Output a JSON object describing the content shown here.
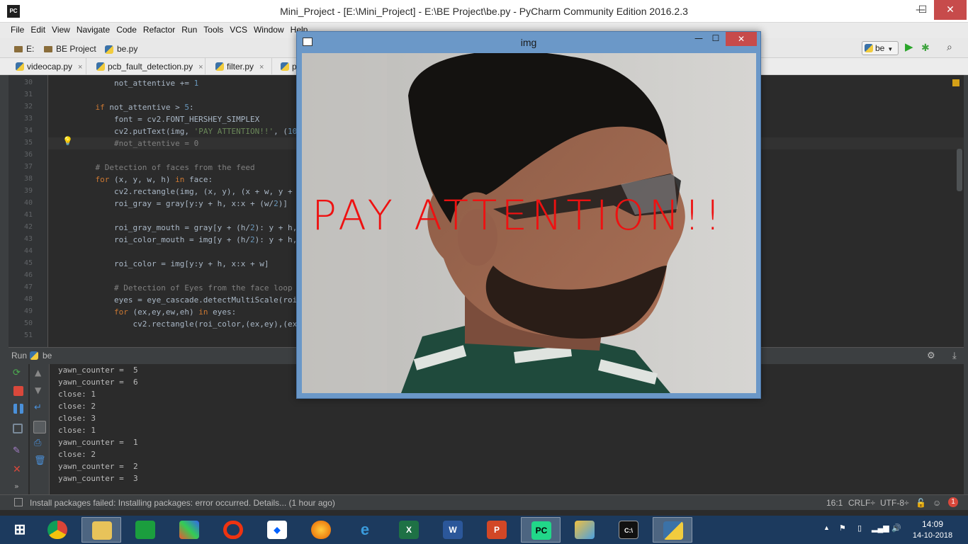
{
  "window": {
    "title": "Mini_Project - [E:\\Mini_Project] - E:\\BE Project\\be.py - PyCharm Community Edition 2016.2.3",
    "logo_text": "PC",
    "minimize": "—",
    "maximize": "☐",
    "close": "✕"
  },
  "menu": [
    "File",
    "Edit",
    "View",
    "Navigate",
    "Code",
    "Refactor",
    "Run",
    "Tools",
    "VCS",
    "Window",
    "Help"
  ],
  "breadcrumb": {
    "drive": "E:",
    "folder": "BE Project",
    "file": "be.py"
  },
  "run_config": {
    "label": "be"
  },
  "tabs": [
    {
      "label": "videocap.py",
      "close": "×"
    },
    {
      "label": "pcb_fault_detection.py",
      "close": "×"
    },
    {
      "label": "filter.py",
      "close": "×"
    },
    {
      "label": "p",
      "close": ""
    }
  ],
  "editor": {
    "lines": [
      {
        "n": "30",
        "code": "        not_attentive += 1"
      },
      {
        "n": "31",
        "code": ""
      },
      {
        "n": "32",
        "code": "    if not_attentive > 5:"
      },
      {
        "n": "33",
        "code": "        font = cv2.FONT_HERSHEY_SIMPLEX"
      },
      {
        "n": "34",
        "code": "        cv2.putText(img, 'PAY ATTENTION!!', (10,"
      },
      {
        "n": "35",
        "code": "        #not_attentive = 0"
      },
      {
        "n": "36",
        "code": ""
      },
      {
        "n": "37",
        "code": "    # Detection of faces from the feed"
      },
      {
        "n": "38",
        "code": "    for (x, y, w, h) in face:"
      },
      {
        "n": "39",
        "code": "        cv2.rectangle(img, (x, y), (x + w, y + h"
      },
      {
        "n": "40",
        "code": "        roi_gray = gray[y:y + h, x:x + (w/2)]"
      },
      {
        "n": "41",
        "code": ""
      },
      {
        "n": "42",
        "code": "        roi_gray_mouth = gray[y + (h/2): y + h,"
      },
      {
        "n": "43",
        "code": "        roi_color_mouth = img[y + (h/2): y + h,"
      },
      {
        "n": "44",
        "code": ""
      },
      {
        "n": "45",
        "code": "        roi_color = img[y:y + h, x:x + w]"
      },
      {
        "n": "46",
        "code": ""
      },
      {
        "n": "47",
        "code": "        # Detection of Eyes from the face loop"
      },
      {
        "n": "48",
        "code": "        eyes = eye_cascade.detectMultiScale(roi_"
      },
      {
        "n": "49",
        "code": "        for (ex,ey,ew,eh) in eyes:"
      },
      {
        "n": "50",
        "code": "            cv2.rectangle(roi_color,(ex,ey),(ex+"
      },
      {
        "n": "51",
        "code": ""
      }
    ]
  },
  "run": {
    "header_label": "Run",
    "config": "be",
    "output": [
      "yawn_counter =  5",
      "yawn_counter =  6",
      "close: 1",
      "close: 2",
      "close: 3",
      "close: 1",
      "yawn_counter =  1",
      "close: 2",
      "yawn_counter =  2",
      "yawn_counter =  3"
    ]
  },
  "status": {
    "message": "Install packages failed: Installing packages: error occurred. Details... (1 hour ago)",
    "position": "16:1",
    "line_sep": "CRLF÷",
    "encoding": "UTF-8÷",
    "badge": "1"
  },
  "img_window": {
    "title": "img",
    "overlay": "PAY ATTENTION!!"
  },
  "taskbar": {
    "time": "14:09",
    "date": "14-10-2018"
  },
  "colors": {
    "keyword": "#cc7832",
    "string": "#6a8759",
    "number": "#6897bb",
    "comment": "#808080",
    "overlay": "#e11111"
  }
}
